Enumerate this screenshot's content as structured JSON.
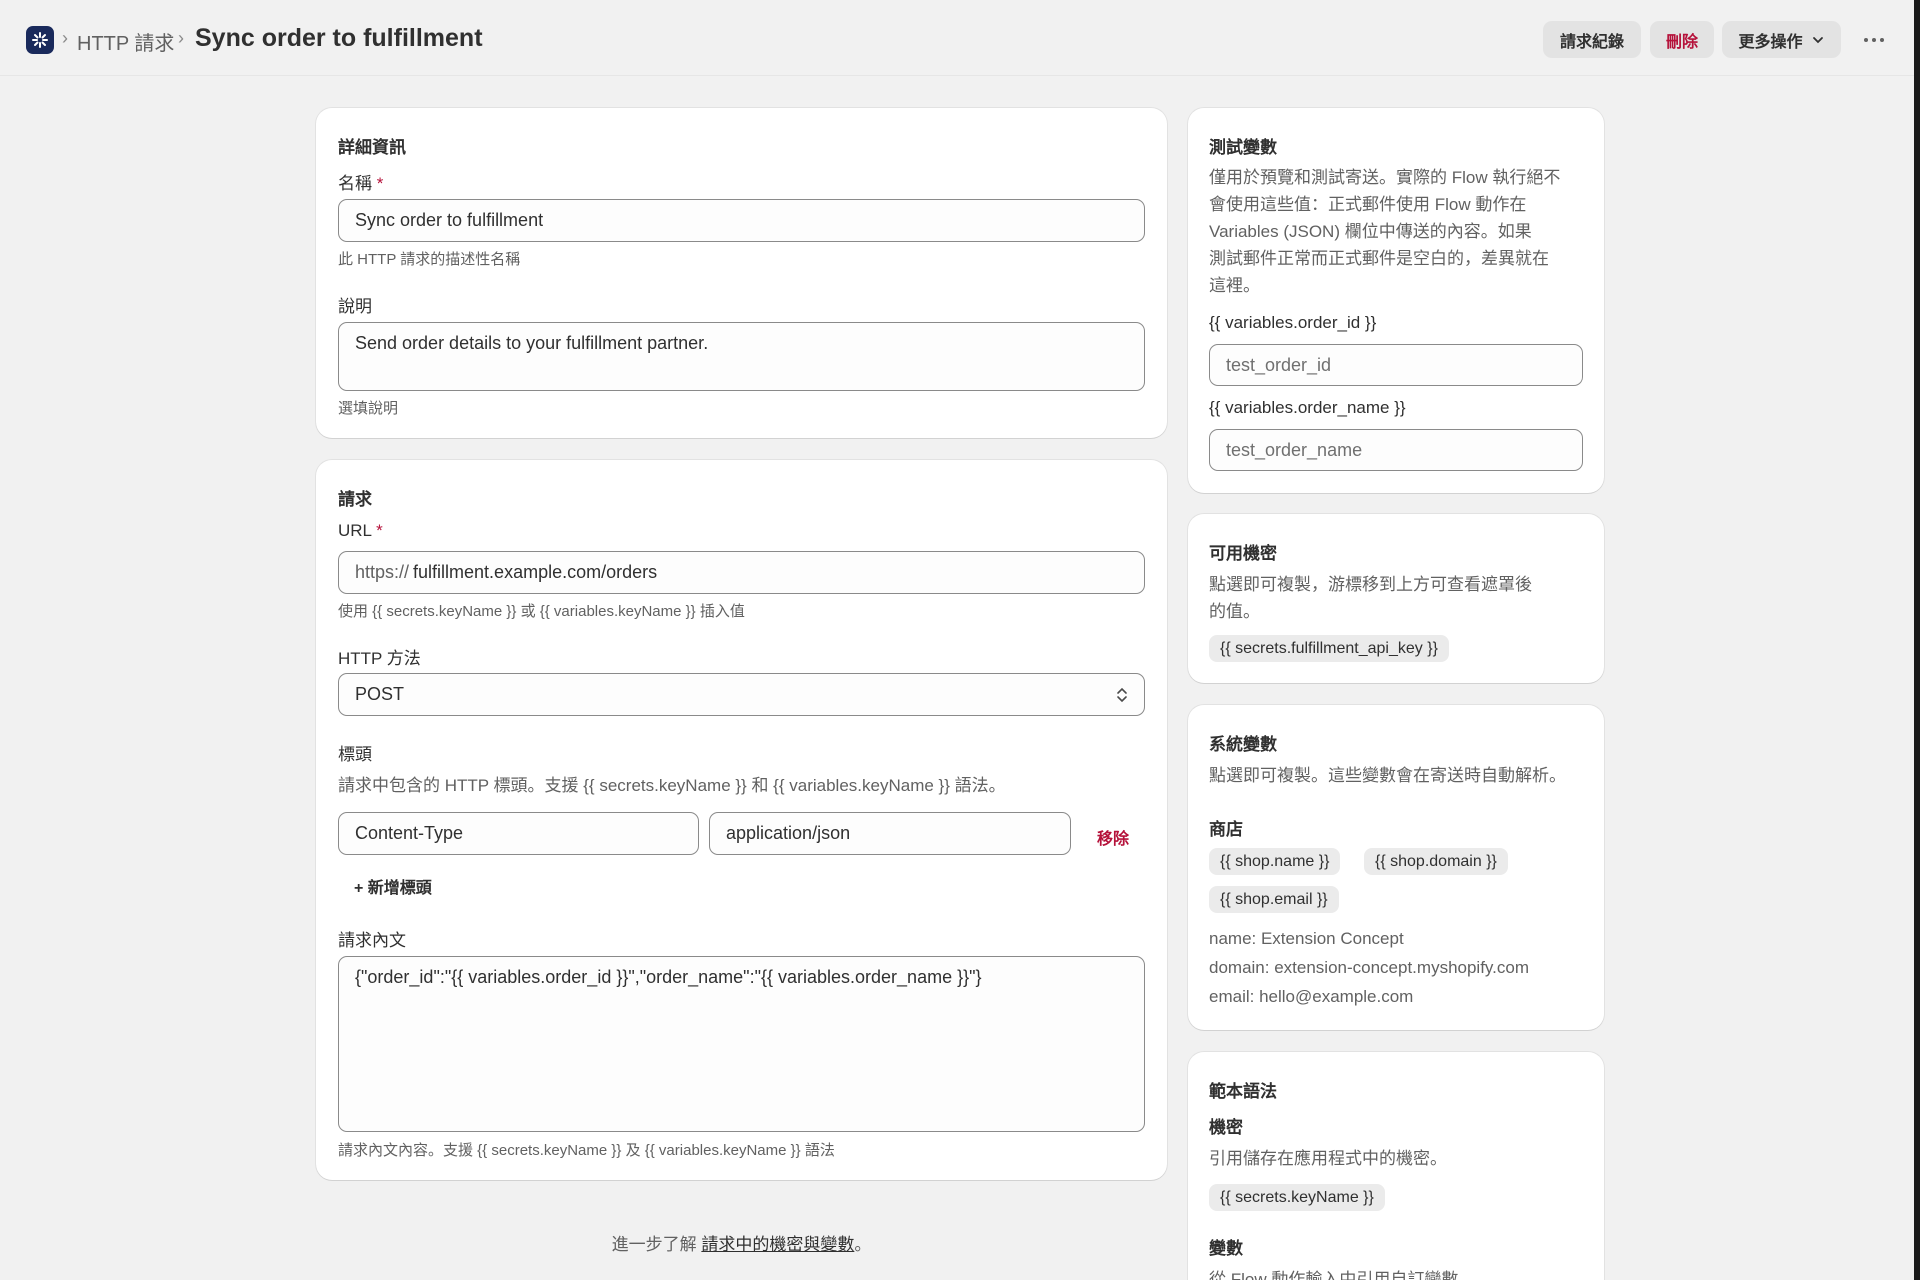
{
  "breadcrumb": {
    "parent": "HTTP 請求",
    "sep": "›",
    "title": "Sync order to fulfillment"
  },
  "toolbar": {
    "history_label": "請求紀錄",
    "delete_label": "刪除",
    "more_label": "更多操作"
  },
  "details": {
    "heading": "詳細資訊",
    "name_label": "名稱",
    "required_mark": "*",
    "name_value": "Sync order to fulfillment",
    "name_help": "此 HTTP 請求的描述性名稱",
    "desc_label": "說明",
    "desc_value": "Send order details to your fulfillment partner.",
    "desc_help": "選填說明"
  },
  "request": {
    "heading": "請求",
    "url_label": "URL",
    "url_prefix": "https://",
    "url_value": "fulfillment.example.com/orders",
    "url_help": "使用 {{ secrets.keyName }} 或 {{ variables.keyName }} 插入值",
    "method_label": "HTTP 方法",
    "method_value": "POST",
    "headers_label": "標頭",
    "headers_help": "請求中包含的 HTTP 標頭。支援 {{ secrets.keyName }} 和 {{ variables.keyName }} 語法。",
    "header_rows": [
      {
        "key": "Content-Type",
        "value": "application/json",
        "remove": "移除"
      }
    ],
    "add_header": "+ 新增標頭",
    "body_label": "請求內文",
    "body_value": "{\"order_id\":\"{{ variables.order_id }}\",\"order_name\":\"{{ variables.order_name }}\"}",
    "body_help": "請求內文內容。支援 {{ secrets.keyName }} 及 {{ variables.keyName }} 語法"
  },
  "footer": {
    "prefix": "進一步了解",
    "link": "請求中的機密與變數",
    "suffix": "。"
  },
  "test_vars": {
    "heading": "測試變數",
    "lines": [
      "僅用於預覽和測試寄送。實際的 Flow 執行絕不",
      "會使用這些值：正式郵件使用 Flow 動作在",
      "Variables (JSON) 欄位中傳送的內容。如果",
      "測試郵件正常而正式郵件是空白的，差異就在",
      "這裡。"
    ],
    "var1_label": "{{ variables.order_id }}",
    "var1_placeholder": "test_order_id",
    "var2_label": "{{ variables.order_name }}",
    "var2_placeholder": "test_order_name"
  },
  "secrets": {
    "heading": "可用機密",
    "lines": [
      "點選即可複製，游標移到上方可查看遮罩後",
      "的值。"
    ],
    "items": [
      "{{ secrets.fulfillment_api_key }}"
    ]
  },
  "system_vars": {
    "heading": "系統變數",
    "desc": "點選即可複製。這些變數會在寄送時自動解析。",
    "shop_heading": "商店",
    "pills": [
      "{{ shop.name }}",
      "{{ shop.domain }}",
      "{{ shop.email }}"
    ],
    "values": [
      "name: Extension Concept",
      "domain: extension-concept.myshopify.com",
      "email: hello@example.com"
    ]
  },
  "syntax": {
    "heading": "範本語法",
    "secrets_heading": "機密",
    "secrets_desc": "引用儲存在應用程式中的機密。",
    "secrets_pill": "{{ secrets.keyName }}",
    "vars_heading": "變數",
    "vars_desc": "從 Flow 動作輸入中引用自訂變數"
  },
  "colors": {
    "accent_danger": "#b5113a",
    "app_icon": "#1a2a5c",
    "page_bg": "#f1f1f1"
  }
}
